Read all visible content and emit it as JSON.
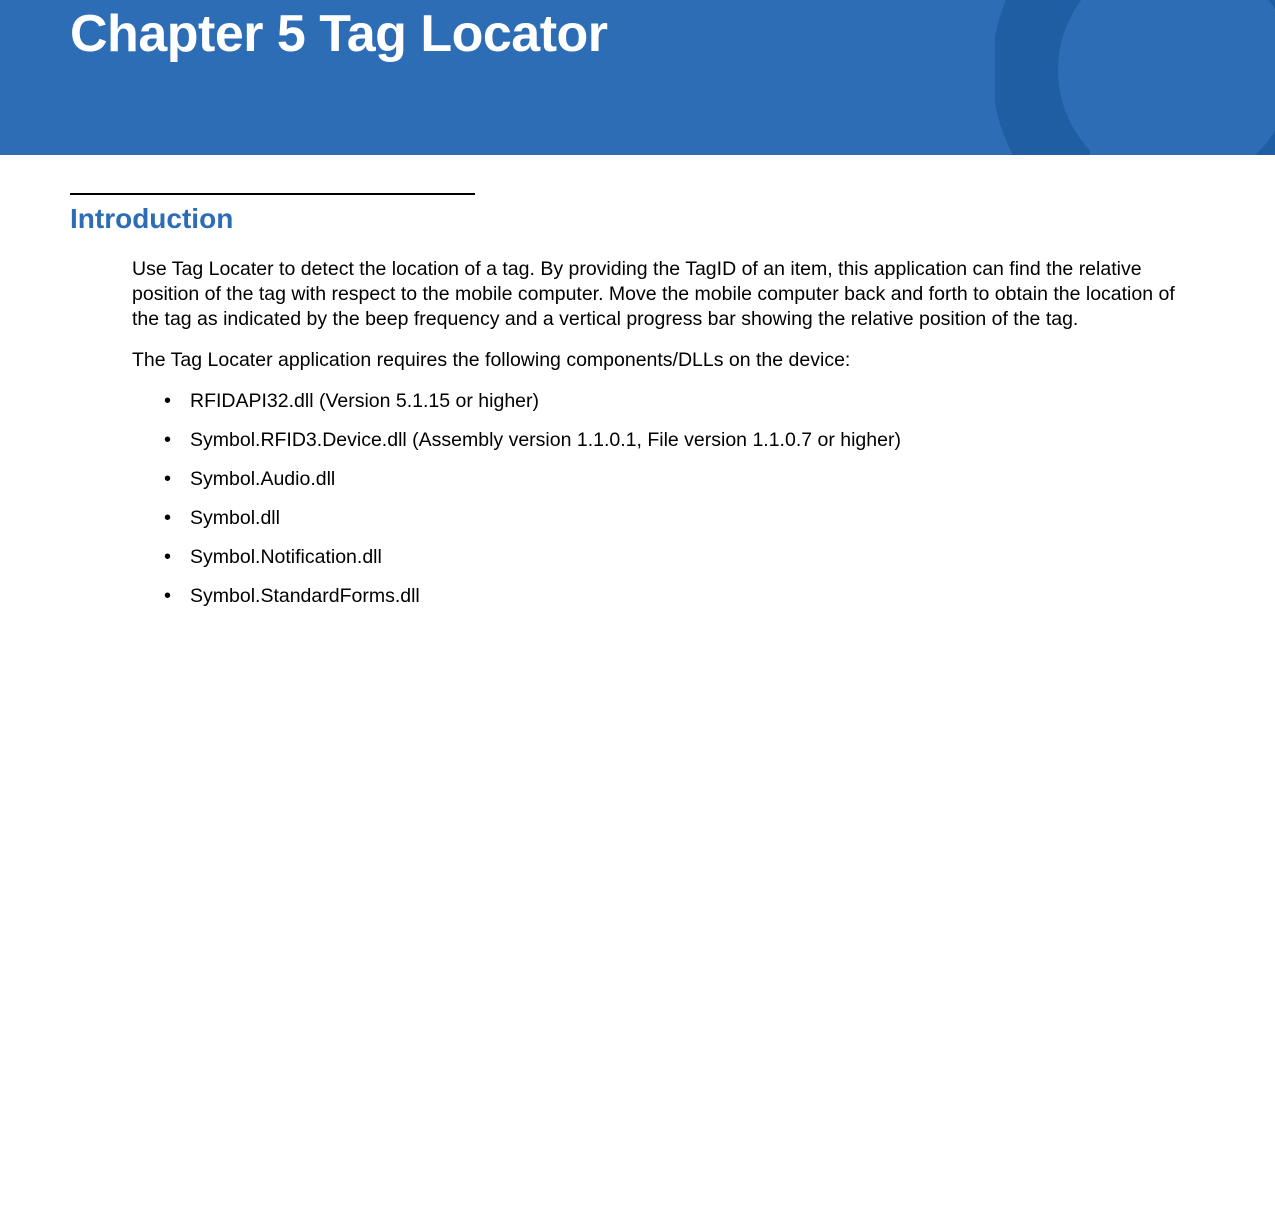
{
  "banner": {
    "title": "Chapter 5 Tag Locator"
  },
  "section": {
    "heading": "Introduction",
    "para1": "Use Tag Locater to detect the location of a tag. By providing the TagID of an item, this application can find the relative position of the tag with respect to the mobile computer. Move the mobile computer back and forth to obtain the location of the tag as indicated by the beep frequency and a vertical progress bar showing the relative position of the tag.",
    "para2": "The Tag Locater application requires the following components/DLLs on the device:",
    "bullets": [
      "RFIDAPI32.dll (Version 5.1.15 or higher)",
      "Symbol.RFID3.Device.dll (Assembly version 1.1.0.1, File version 1.1.0.7 or higher)",
      "Symbol.Audio.dll",
      "Symbol.dll",
      "Symbol.Notification.dll",
      "Symbol.StandardForms.dll"
    ]
  }
}
